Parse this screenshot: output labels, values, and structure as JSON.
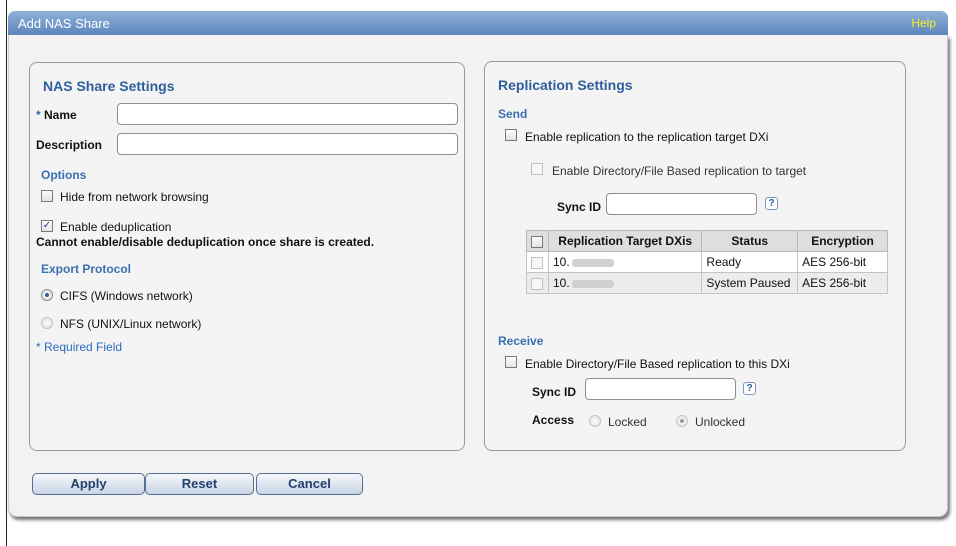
{
  "window": {
    "title": "Add NAS Share",
    "help_label": "Help"
  },
  "nas": {
    "heading": "NAS Share Settings",
    "name_label": "Name",
    "name_value": "",
    "description_label": "Description",
    "description_value": "",
    "options_heading": "Options",
    "hide_browsing_label": "Hide from network browsing",
    "hide_browsing_checked": false,
    "dedup_label": "Enable deduplication",
    "dedup_checked": true,
    "dedup_note": "Cannot enable/disable deduplication once share is created.",
    "export_heading": "Export Protocol",
    "cifs_label": "CIFS (Windows network)",
    "nfs_label": "NFS (UNIX/Linux network)",
    "selected_protocol": "CIFS",
    "required_note": "* Required Field"
  },
  "replication": {
    "heading": "Replication Settings",
    "send_heading": "Send",
    "enable_target_label": "Enable replication to the replication target DXi",
    "enable_dirfile_target_label": "Enable Directory/File Based replication to target",
    "sync_id_label": "Sync ID",
    "sync_id_value": "",
    "help_glyph": "?",
    "table": {
      "columns": [
        "Replication Target DXis",
        "Status",
        "Encryption"
      ],
      "rows": [
        {
          "target": "10.",
          "status": "Ready",
          "encryption": "AES 256-bit"
        },
        {
          "target": "10.",
          "status": "System Paused",
          "encryption": "AES 256-bit"
        }
      ]
    },
    "receive_heading": "Receive",
    "enable_receive_label": "Enable Directory/File Based replication to this DXi",
    "receive_sync_id_label": "Sync ID",
    "receive_sync_id_value": "",
    "access_label": "Access",
    "locked_label": "Locked",
    "unlocked_label": "Unlocked",
    "selected_access": "Unlocked"
  },
  "buttons": {
    "apply": "Apply",
    "reset": "Reset",
    "cancel": "Cancel"
  },
  "colors": {
    "title_bar": "#6f93c6",
    "heading_blue": "#2f5f9a",
    "help_yellow": "#f4ee2a"
  }
}
